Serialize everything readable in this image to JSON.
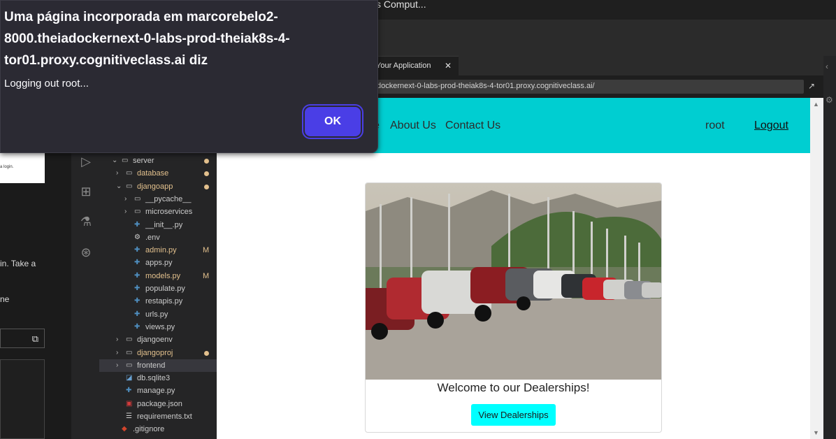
{
  "window": {
    "title_partial": "s Comput..."
  },
  "dialog": {
    "heading": "Uma página incorporada em marcorebelo2-8000.theiadockernext-0-labs-prod-theiak8s-4-tor01.proxy.cognitiveclass.ai diz",
    "message": "Logging out root...",
    "ok_label": "OK"
  },
  "left_pane": {
    "small_text": "a login.",
    "line1": "in. Take a",
    "line2": "ne"
  },
  "explorer": {
    "items": [
      {
        "label": "server",
        "kind": "folder-open",
        "level": 0,
        "dot": true
      },
      {
        "label": "database",
        "kind": "folder",
        "level": 1,
        "dot": true,
        "modified": true
      },
      {
        "label": "djangoapp",
        "kind": "folder-open",
        "level": 1,
        "dot": true,
        "modified": true
      },
      {
        "label": "__pycache__",
        "kind": "folder",
        "level": 2
      },
      {
        "label": "microservices",
        "kind": "folder",
        "level": 2
      },
      {
        "label": "__init__.py",
        "kind": "py",
        "level": 2
      },
      {
        "label": ".env",
        "kind": "gear",
        "level": 2
      },
      {
        "label": "admin.py",
        "kind": "py",
        "level": 2,
        "flag": "M",
        "modified": true
      },
      {
        "label": "apps.py",
        "kind": "py",
        "level": 2
      },
      {
        "label": "models.py",
        "kind": "py",
        "level": 2,
        "flag": "M",
        "modified": true
      },
      {
        "label": "populate.py",
        "kind": "py",
        "level": 2
      },
      {
        "label": "restapis.py",
        "kind": "py",
        "level": 2
      },
      {
        "label": "urls.py",
        "kind": "py",
        "level": 2
      },
      {
        "label": "views.py",
        "kind": "py",
        "level": 2
      },
      {
        "label": "djangoenv",
        "kind": "folder",
        "level": 1
      },
      {
        "label": "djangoproj",
        "kind": "folder",
        "level": 1,
        "dot": true,
        "modified": true
      },
      {
        "label": "frontend",
        "kind": "folder",
        "level": 1,
        "selected": true
      },
      {
        "label": "db.sqlite3",
        "kind": "db",
        "level": 1
      },
      {
        "label": "manage.py",
        "kind": "py",
        "level": 1
      },
      {
        "label": "package.json",
        "kind": "json",
        "level": 1
      },
      {
        "label": "requirements.txt",
        "kind": "txt",
        "level": 1
      },
      {
        "label": ".gitignore",
        "kind": "git",
        "level": 0
      }
    ]
  },
  "preview": {
    "tab_label": "Your Application",
    "tab_close": "✕",
    "url": "dockernext-0-labs-prod-theiak8s-4-tor01.proxy.cognitiveclass.ai/"
  },
  "webpage": {
    "nav": {
      "home_partial": "e",
      "about": "About Us",
      "contact": "Contact Us",
      "user": "root",
      "logout": "Logout"
    },
    "card": {
      "title": "Welcome to our Dealerships!",
      "button": "View Dealerships"
    }
  },
  "colors": {
    "navbar": "#00ced1",
    "button": "#00ffff",
    "ok_button": "#4a3ee6",
    "dialog_bg": "#2b2a33",
    "modified": "#e2c08d"
  }
}
